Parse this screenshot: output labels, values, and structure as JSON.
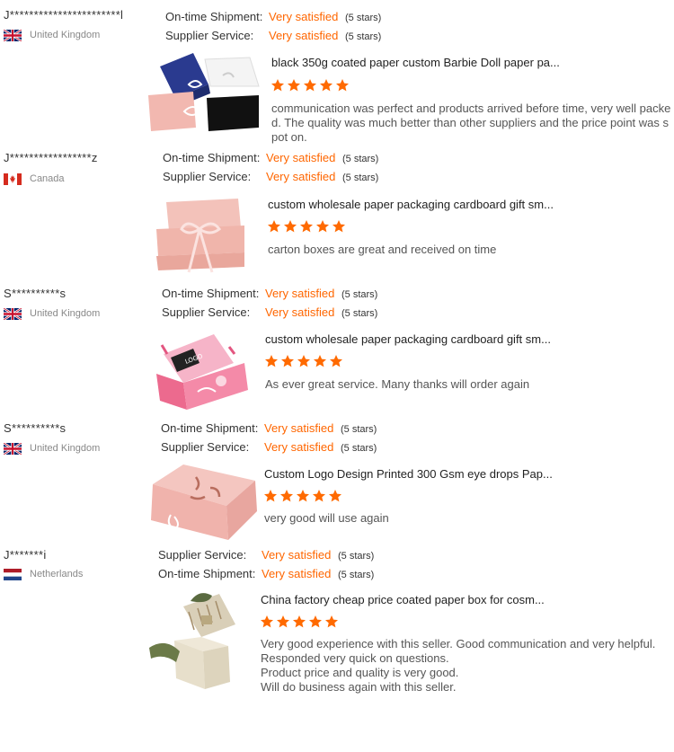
{
  "star_icon": "star-icon",
  "reviews": [
    {
      "buyer": "J***********************l",
      "country": "United Kingdom",
      "flag": "uk",
      "ratings": [
        {
          "label": "On-time Shipment:",
          "value": "Very satisfied",
          "stars": "(5 stars)"
        },
        {
          "label": "Supplier Service:",
          "value": "Very satisfied",
          "stars": "(5 stars)"
        }
      ],
      "product_title": "black 350g coated paper custom Barbie Doll paper pa...",
      "comment": "communication was perfect and products arrived before time, very well packed. The quality was much better than other suppliers and the price point was spot on."
    },
    {
      "buyer": "J*****************z",
      "country": "Canada",
      "flag": "ca",
      "ratings": [
        {
          "label": "On-time Shipment:",
          "value": "Very satisfied",
          "stars": "(5 stars)"
        },
        {
          "label": "Supplier Service:",
          "value": "Very satisfied",
          "stars": "(5 stars)"
        }
      ],
      "product_title": "custom wholesale paper packaging cardboard gift sm...",
      "comment": "carton boxes are great and received on time"
    },
    {
      "buyer": "S**********s",
      "country": "United Kingdom",
      "flag": "uk",
      "ratings": [
        {
          "label": "On-time Shipment:",
          "value": "Very satisfied",
          "stars": "(5 stars)"
        },
        {
          "label": "Supplier Service:",
          "value": "Very satisfied",
          "stars": "(5 stars)"
        }
      ],
      "product_title": "custom wholesale paper packaging cardboard gift sm...",
      "comment": "As ever great service. Many thanks will order again"
    },
    {
      "buyer": "S**********s",
      "country": "United Kingdom",
      "flag": "uk",
      "ratings": [
        {
          "label": "On-time Shipment:",
          "value": "Very satisfied",
          "stars": "(5 stars)"
        },
        {
          "label": "Supplier Service:",
          "value": "Very satisfied",
          "stars": "(5 stars)"
        }
      ],
      "product_title": "Custom Logo Design Printed 300 Gsm eye drops Pap...",
      "comment": "very good will use again"
    },
    {
      "buyer": "J*******i",
      "country": "Netherlands",
      "flag": "nl",
      "ratings": [
        {
          "label": "Supplier Service:",
          "value": "Very satisfied",
          "stars": "(5 stars)"
        },
        {
          "label": "On-time Shipment:",
          "value": "Very satisfied",
          "stars": "(5 stars)"
        }
      ],
      "product_title": "China factory cheap price coated paper box for cosm...",
      "comment_lines": [
        "Very good experience with this seller. Good communication and very helpful.",
        "Responded very quick on questions.",
        "Product price and quality is very good.",
        "Will do business again with this seller."
      ]
    }
  ],
  "colors": {
    "accent": "#ff6600",
    "star": "#ff6a00"
  }
}
